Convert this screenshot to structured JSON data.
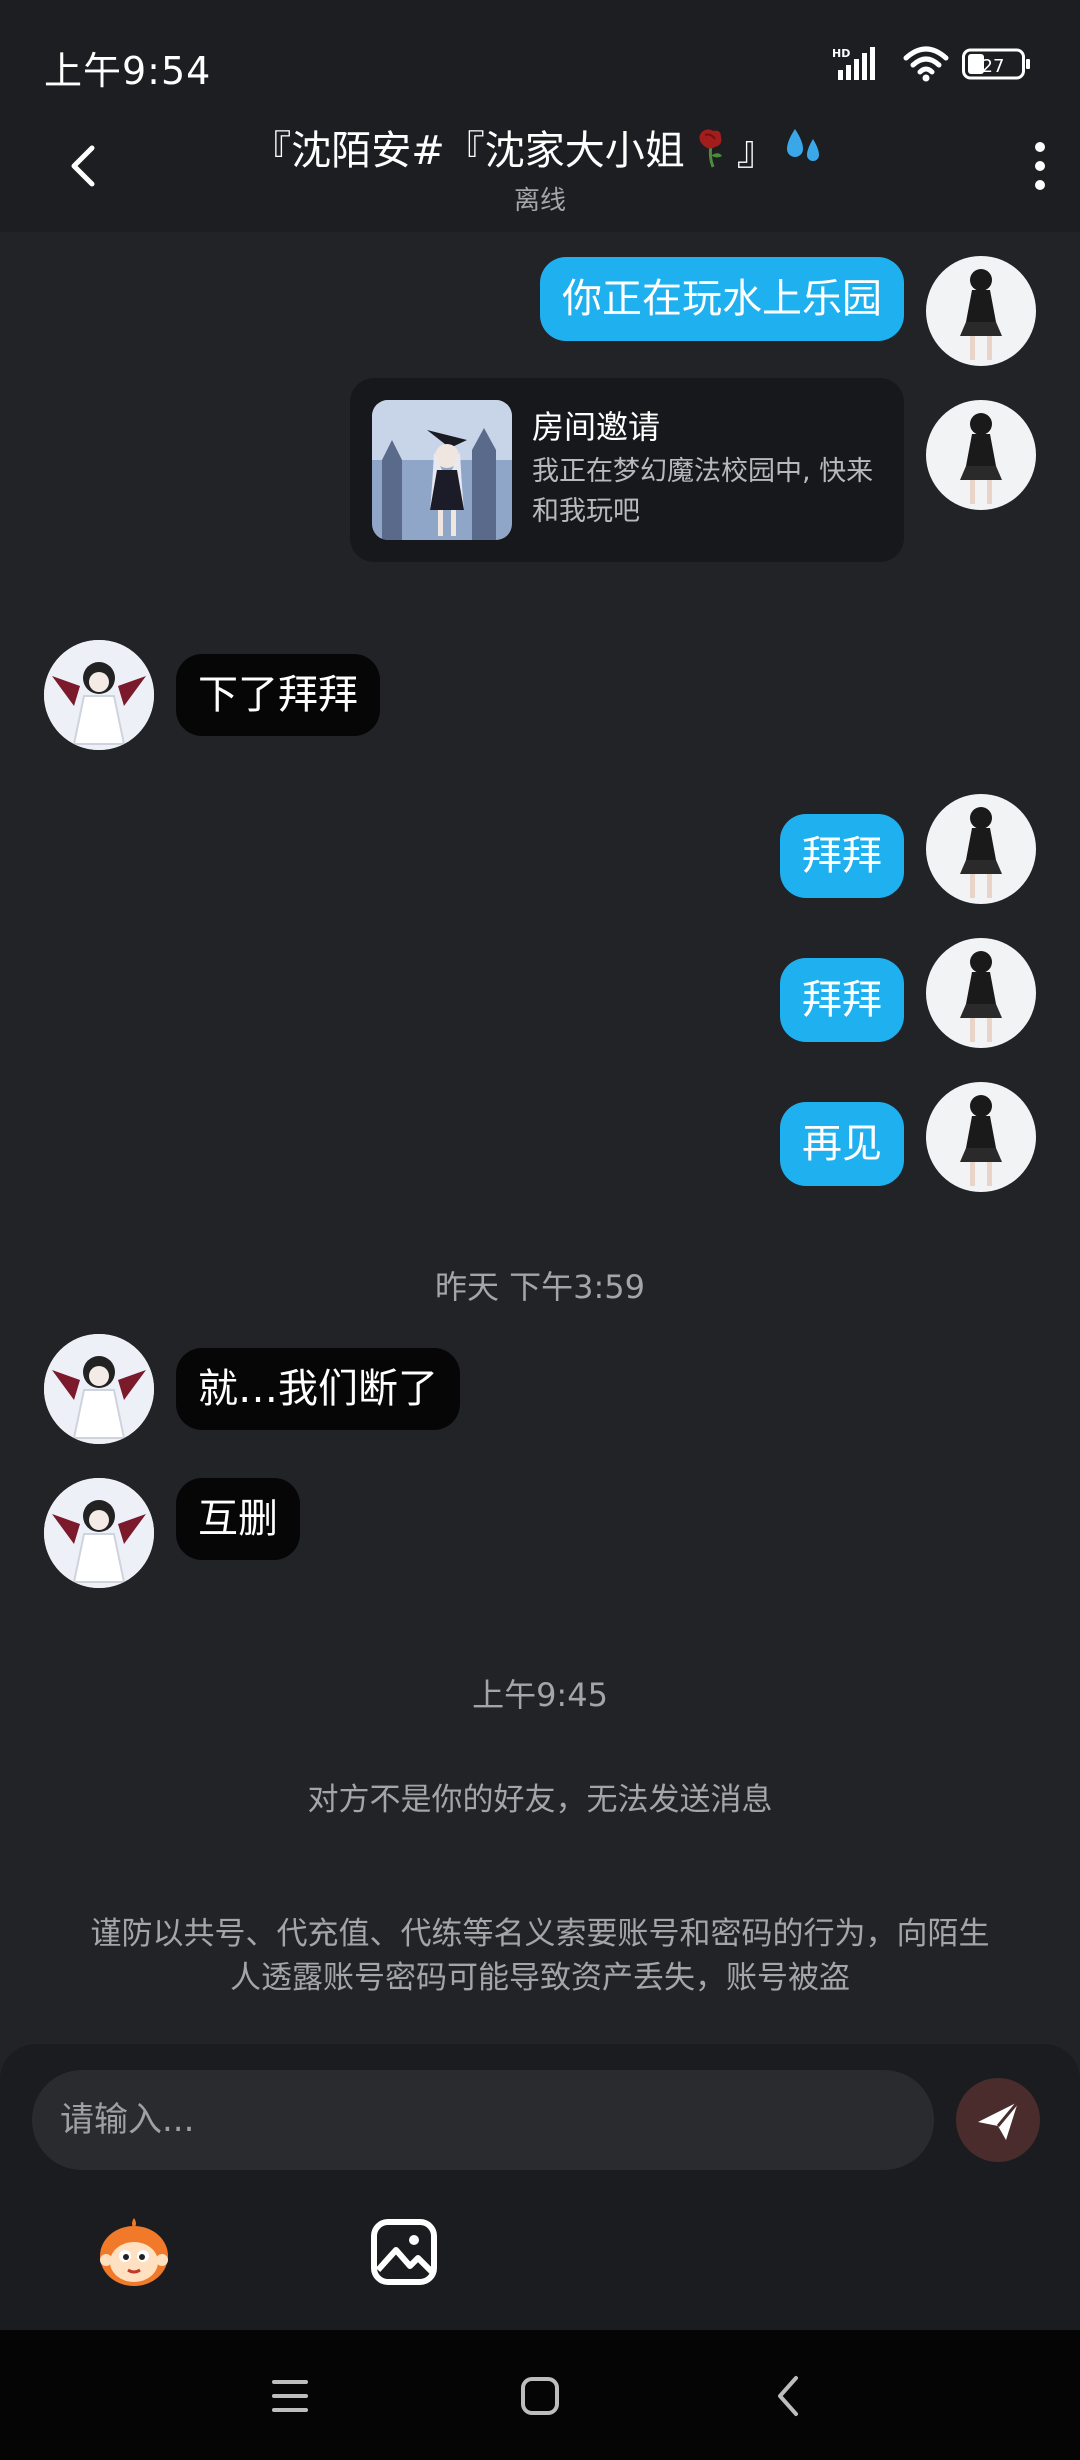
{
  "status_bar": {
    "time": "上午9:54",
    "network_label": "HD",
    "battery": "27"
  },
  "header": {
    "title_part1": "『沈陌安#『沈家大小姐",
    "title_part2": "』",
    "status": "离线",
    "icons": [
      "back-icon",
      "wilted-rose-icon",
      "sweat-droplets-icon",
      "more-vertical-icon"
    ]
  },
  "messages": [
    {
      "from": "me",
      "text": "你正在玩水上乐园"
    },
    {
      "from": "me",
      "type": "invite",
      "title": "房间邀请",
      "desc": "我正在梦幻魔法校园中, 快来和我玩吧"
    },
    {
      "from": "other",
      "text": "下了拜拜"
    },
    {
      "from": "me",
      "text": "拜拜"
    },
    {
      "from": "me",
      "text": "拜拜"
    },
    {
      "from": "me",
      "text": "再见"
    },
    {
      "type": "time",
      "text": "昨天 下午3:59"
    },
    {
      "from": "other",
      "text": "就…我们断了"
    },
    {
      "from": "other",
      "text": "互删"
    },
    {
      "type": "time",
      "text": "上午9:45"
    },
    {
      "type": "system",
      "text": "对方不是你的好友，无法发送消息"
    },
    {
      "type": "system",
      "text": "谨防以共号、代充值、代练等名义索要账号和密码的行为，向陌生人透露账号密码可能导致资产丢失，账号被盗"
    }
  ],
  "input": {
    "placeholder": "请输入..."
  },
  "toolbar": [
    "emoji-mascot-icon",
    "image-icon"
  ],
  "colors": {
    "background": "#222327",
    "bubble_me": "#1fb0f0",
    "bubble_other": "#060607",
    "secondary_text": "#a4a5a9"
  }
}
